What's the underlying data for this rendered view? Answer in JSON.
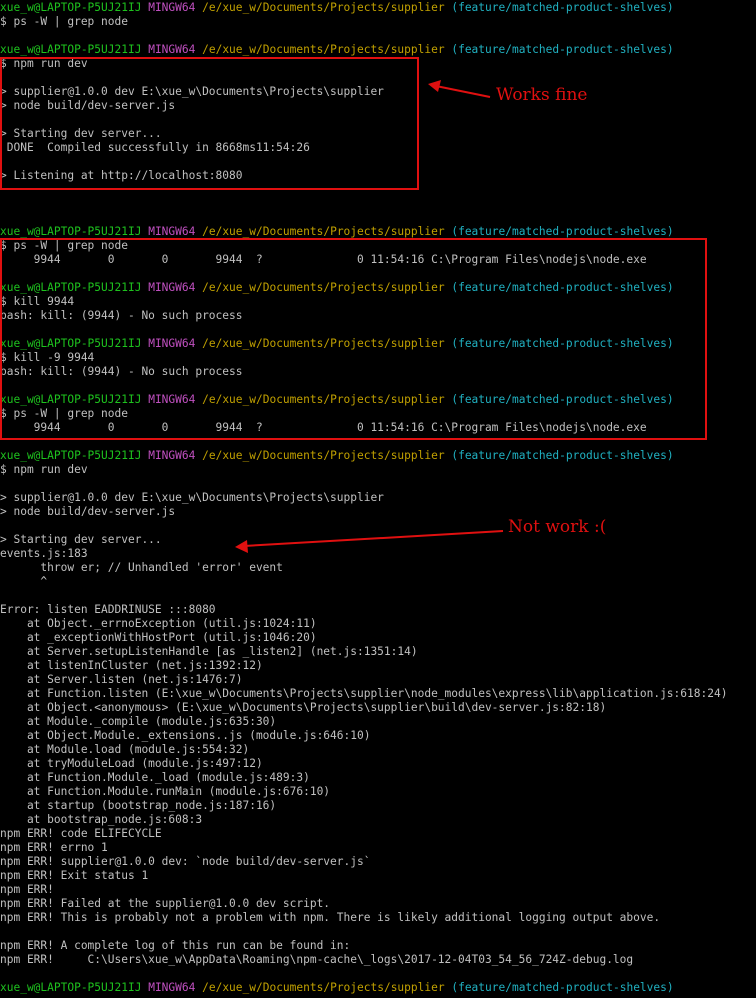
{
  "prompt": {
    "user": "xue_w@LAPTOP-P5UJ21IJ",
    "shell": "MINGW64",
    "path": "/e/xue_w/Documents/Projects/supplier",
    "branch": "(feature/matched-product-shelves)"
  },
  "lines": [
    "$ ps -W | grep node",
    "$ npm run dev",
    "",
    "> supplier@1.0.0 dev E:\\xue_w\\Documents\\Projects\\supplier",
    "> node build/dev-server.js",
    "",
    "> Starting dev server...",
    " DONE  Compiled successfully in 8668ms11:54:26",
    "",
    "> Listening at http://localhost:8080",
    "$ ps -W | grep node",
    "     9944       0       0       9944  ?              0 11:54:16 C:\\Program Files\\nodejs\\node.exe",
    "$ kill 9944",
    "bash: kill: (9944) - No such process",
    "$ kill -9 9944",
    "bash: kill: (9944) - No such process",
    "$ ps -W | grep node",
    "     9944       0       0       9944  ?              0 11:54:16 C:\\Program Files\\nodejs\\node.exe",
    "$ npm run dev",
    "> supplier@1.0.0 dev E:\\xue_w\\Documents\\Projects\\supplier",
    "> node build/dev-server.js",
    "> Starting dev server...",
    "events.js:183",
    "      throw er; // Unhandled 'error' event",
    "      ^",
    "Error: listen EADDRINUSE :::8080",
    "    at Object._errnoException (util.js:1024:11)",
    "    at _exceptionWithHostPort (util.js:1046:20)",
    "    at Server.setupListenHandle [as _listen2] (net.js:1351:14)",
    "    at listenInCluster (net.js:1392:12)",
    "    at Server.listen (net.js:1476:7)",
    "    at Function.listen (E:\\xue_w\\Documents\\Projects\\supplier\\node_modules\\express\\lib\\application.js:618:24)",
    "    at Object.<anonymous> (E:\\xue_w\\Documents\\Projects\\supplier\\build\\dev-server.js:82:18)",
    "    at Module._compile (module.js:635:30)",
    "    at Object.Module._extensions..js (module.js:646:10)",
    "    at Module.load (module.js:554:32)",
    "    at tryModuleLoad (module.js:497:12)",
    "    at Function.Module._load (module.js:489:3)",
    "    at Function.Module.runMain (module.js:676:10)",
    "    at startup (bootstrap_node.js:187:16)",
    "    at bootstrap_node.js:608:3",
    "npm ERR! code ELIFECYCLE",
    "npm ERR! errno 1",
    "npm ERR! supplier@1.0.0 dev: `node build/dev-server.js`",
    "npm ERR! Exit status 1",
    "npm ERR!",
    "npm ERR! Failed at the supplier@1.0.0 dev script.",
    "npm ERR! This is probably not a problem with npm. There is likely additional logging output above.",
    "npm ERR! A complete log of this run can be found in:",
    "npm ERR!     C:\\Users\\xue_w\\AppData\\Roaming\\npm-cache\\_logs\\2017-12-04T03_54_56_724Z-debug.log"
  ],
  "annotations": {
    "works_fine": "Works fine",
    "not_work": "Not work :(",
    "highlight_color": "#e01010"
  },
  "colors": {
    "background": "#000000",
    "text": "#c0c0c0",
    "user": "#1ec21e",
    "shell": "#c050c0",
    "path": "#c0a000",
    "branch": "#20b0c0"
  }
}
